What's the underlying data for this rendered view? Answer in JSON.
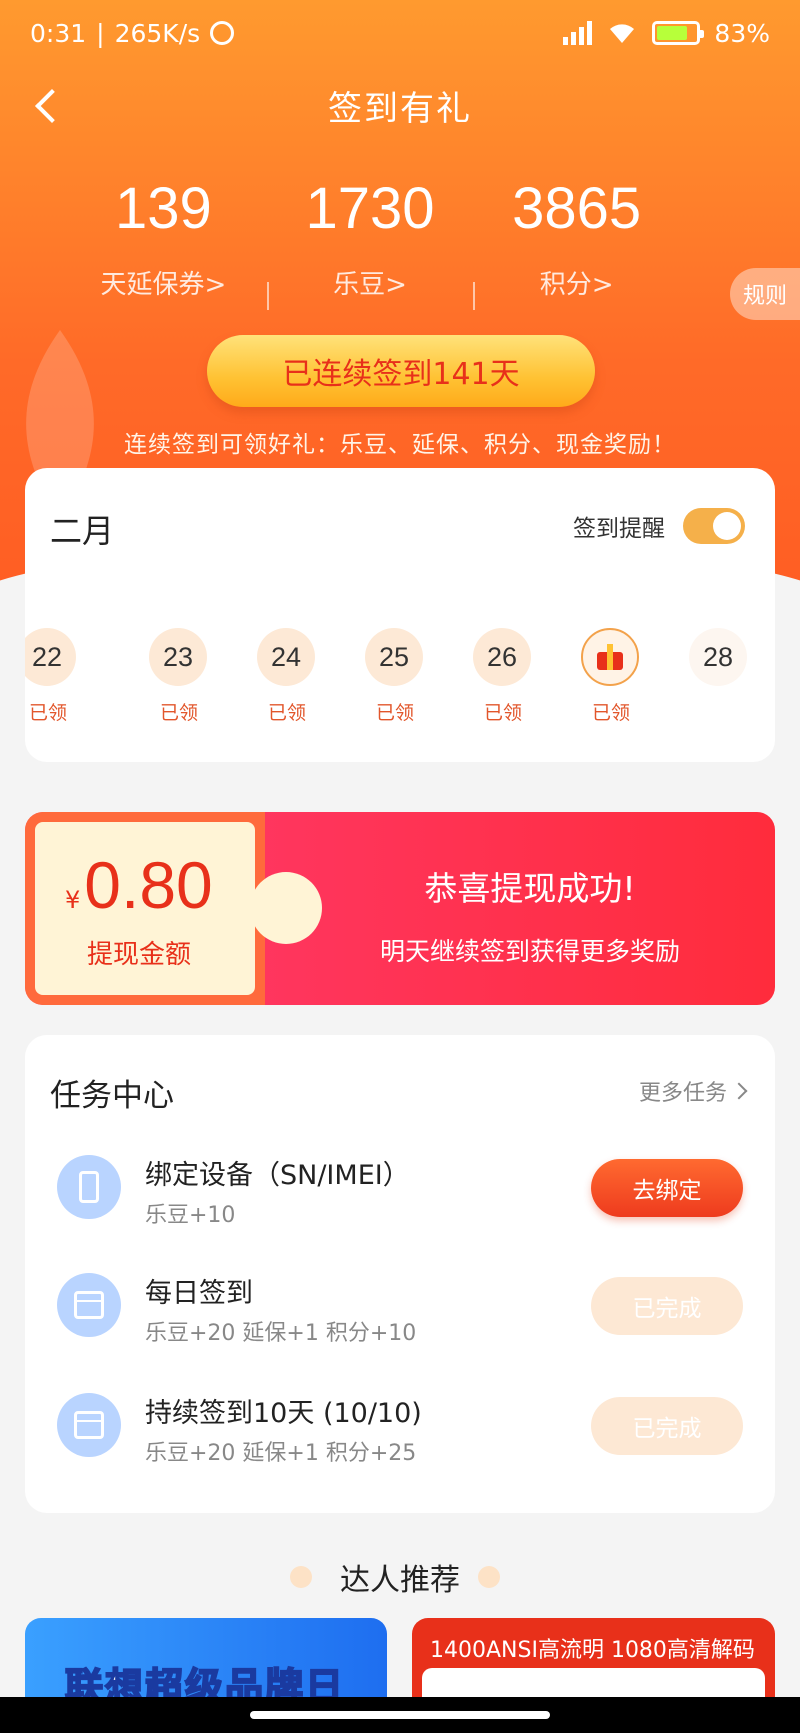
{
  "status": {
    "time": "0:31",
    "speed": "265K/s",
    "battery": "83%"
  },
  "nav": {
    "title": "签到有礼"
  },
  "stats": [
    {
      "value": "139",
      "label": "天延保券>"
    },
    {
      "value": "1730",
      "label": "乐豆>"
    },
    {
      "value": "3865",
      "label": "积分>"
    }
  ],
  "rules_label": "规则",
  "streak": {
    "button": "已连续签到141天",
    "desc": "连续签到可领好礼：乐豆、延保、积分、现金奖励！"
  },
  "calendar": {
    "month": "二月",
    "remind_label": "签到提醒",
    "remind_on": true,
    "days": [
      {
        "day": "22",
        "status": "已领"
      },
      {
        "day": "23",
        "status": "已领"
      },
      {
        "day": "24",
        "status": "已领"
      },
      {
        "day": "25",
        "status": "已领"
      },
      {
        "day": "26",
        "status": "已领"
      },
      {
        "day": "",
        "status": "已领",
        "icon": "gift-icon"
      },
      {
        "day": "28",
        "status": ""
      }
    ]
  },
  "cash": {
    "currency": "¥",
    "amount": "0.80",
    "amount_label": "提现金额",
    "title": "恭喜提现成功!",
    "subtitle": "明天继续签到获得更多奖励"
  },
  "tasks": {
    "title": "任务中心",
    "more": "更多任务",
    "items": [
      {
        "name": "绑定设备（SN/IMEI）",
        "reward": "乐豆+10",
        "button": "去绑定",
        "state": "active",
        "icon": "phone-icon"
      },
      {
        "name": "每日签到",
        "reward": "乐豆+20 延保+1 积分+10",
        "button": "已完成",
        "state": "done",
        "icon": "calendar-icon"
      },
      {
        "name": "持续签到10天 (10/10)",
        "reward": "乐豆+20 延保+1 积分+25",
        "button": "已完成",
        "state": "done",
        "icon": "calendar-check-icon"
      }
    ]
  },
  "recommend": {
    "title": "达人推荐",
    "left_banner": "联想超级品牌日",
    "right_banner": "1400ANSI高流明 1080高清解码"
  },
  "colors": {
    "accent": "#ff6a28",
    "primary_red": "#e8301a",
    "gold": "#ffc233"
  }
}
